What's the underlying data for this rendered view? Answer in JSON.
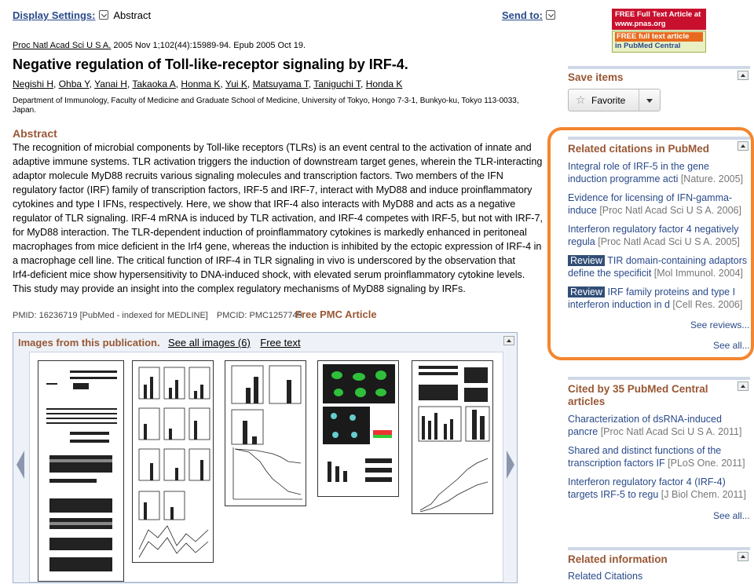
{
  "top": {
    "display_settings_label": "Display Settings:",
    "display_mode": "Abstract",
    "send_to_label": "Send to:"
  },
  "citation": {
    "journal": "Proc Natl Acad Sci U S A.",
    "details": " 2005 Nov 1;102(44):15989-94. Epub 2005 Oct 19."
  },
  "article": {
    "title": "Negative regulation of Toll-like-receptor signaling by IRF-4.",
    "authors": [
      "Negishi H",
      "Ohba Y",
      "Yanai H",
      "Takaoka A",
      "Honma K",
      "Yui K",
      "Matsuyama T",
      "Taniguchi T",
      "Honda K"
    ],
    "affiliation_line1": "Department of Immunology, Faculty of Medicine and Graduate School of Medicine, University of Tokyo, Hongo 7-3-1, Bunkyo-ku, Tokyo 113-0033,",
    "affiliation_line2": "Japan.",
    "abstract_heading": "Abstract",
    "abstract_lines": [
      "The recognition of microbial components by Toll-like receptors (TLRs) is an event central to the activation of innate and",
      "adaptive immune systems. TLR activation triggers the induction of downstream target genes, wherein the TLR-interacting",
      "adaptor molecule MyD88 recruits various signaling molecules and transcription factors. Two members of the IFN",
      "regulatory factor (IRF) family of transcription factors, IRF-5 and IRF-7, interact with MyD88 and induce proinflammatory",
      "cytokines and type I IFNs, respectively. Here, we show that IRF-4 also interacts with MyD88 and acts as a negative",
      "regulator of TLR signaling. IRF-4 mRNA is induced by TLR activation, and IRF-4 competes with IRF-5, but not with IRF-7,",
      "for MyD88 interaction. The TLR-dependent induction of proinflammatory cytokines is markedly enhanced in peritoneal",
      "macrophages from mice deficient in the Irf4 gene, whereas the induction is inhibited by the ectopic expression of IRF-4 in",
      "a macrophage cell line. The critical function of IRF-4 in TLR signaling in vivo is underscored by the observation that",
      "Irf4-deficient mice show hypersensitivity to DNA-induced shock, with elevated serum proinflammatory cytokine levels.",
      "This study may provide an insight into the complex regulatory mechanisms of MyD88 signaling by IRFs."
    ],
    "pmid": "PMID: 16236719 [PubMed - indexed for MEDLINE]",
    "pmcid": "PMCID: PMC1257749",
    "free_pmc": "Free PMC Article"
  },
  "images_panel": {
    "heading": "Images from this publication.",
    "see_all": "See all images (6)",
    "free_text": "Free text"
  },
  "badges": {
    "pnas_line1": "FREE Full Text Article at",
    "pnas_line2": "www.pnas.org",
    "pmc_line1": "FREE full text article",
    "pmc_line2": "in PubMed Central"
  },
  "save_items": {
    "title": "Save items",
    "favorite_label": "Favorite"
  },
  "related_citations": {
    "title": "Related citations in PubMed",
    "items": [
      {
        "badge": "",
        "line1": "Integral role of IRF-5 in the gene",
        "line2_text": "induction programme acti",
        "line2_src": "[Nature. 2005]"
      },
      {
        "badge": "",
        "line1": "Evidence for licensing of IFN-gamma-",
        "line2_text": "induce",
        "line2_src": "[Proc Natl Acad Sci U S A. 2006]"
      },
      {
        "badge": "",
        "line1": "Interferon regulatory factor 4 negatively",
        "line2_text": "regula",
        "line2_src": "[Proc Natl Acad Sci U S A. 2005]"
      },
      {
        "badge": "Review",
        "line1": "TIR domain-containing adaptors",
        "line2_text": "define the specificit",
        "line2_src": "[Mol Immunol. 2004]"
      },
      {
        "badge": "Review",
        "line1": "IRF family proteins and type I",
        "line2_text": "interferon induction in d",
        "line2_src": "[Cell Res. 2006]"
      }
    ],
    "see_reviews": "See reviews...",
    "see_all": "See all..."
  },
  "cited_by": {
    "title_line1": "Cited by 35 PubMed Central",
    "title_line2": "articles",
    "items": [
      {
        "line1": "Characterization of dsRNA-induced",
        "line2_text": "pancre",
        "line2_src": "[Proc Natl Acad Sci U S A. 2011]"
      },
      {
        "line1": "Shared and distinct functions of the",
        "line2_text": "transcription factors IF",
        "line2_src": "[PLoS One. 2011]"
      },
      {
        "line1": "Interferon regulatory factor 4 (IRF-4)",
        "line2_text": "targets IRF-5 to regu",
        "line2_src": "[J Biol Chem. 2011]"
      }
    ],
    "see_all": "See all..."
  },
  "related_info": {
    "title": "Related information",
    "first_item": "Related Citations"
  },
  "colors": {
    "section_heading": "#985735",
    "link": "#2a4a8a",
    "highlight_ring": "#f3862e",
    "review_badge": "#324e77"
  }
}
